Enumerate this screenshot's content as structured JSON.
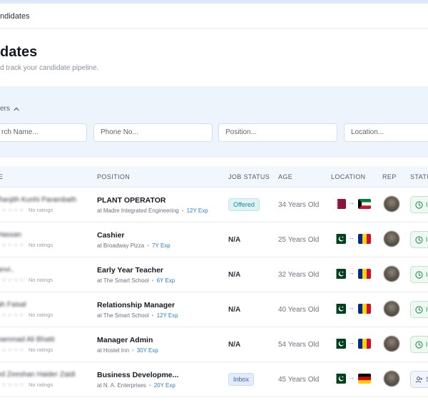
{
  "breadcrumb": "ndidates",
  "page": {
    "title": "dates",
    "subtitle": "d track your candidate pipeline."
  },
  "filters": {
    "toggle_label": "ers",
    "name_placeholder": "rch Name...",
    "phone_placeholder": "Phone No...",
    "position_placeholder": "Position...",
    "location_placeholder": "Location..."
  },
  "table": {
    "headers": {
      "name": "E",
      "position": "POSITION",
      "job_status": "JOB STATUS",
      "age": "AGE",
      "location": "LOCATION",
      "rep": "REP",
      "status": "STATU"
    },
    "rows": [
      {
        "name": "Ranjith Kunhi Parambath",
        "stars": "☆☆☆☆☆",
        "ratings": "No ratings",
        "position": "PLANT OPERATOR",
        "company": "at Madre Integrated Engineering",
        "exp": "12Y Exp",
        "job_status": "Offered",
        "age": "34 Years Old",
        "from_flag": "qatar",
        "to_flag": "kuwait",
        "status_icon": "clock-icon",
        "status_text": "I"
      },
      {
        "name": "Hassan",
        "stars": "☆☆☆☆☆",
        "ratings": "No ratings",
        "position": "Cashier",
        "company": "at Broadway Pizza",
        "exp": "7Y Exp",
        "job_status": "N/A",
        "age": "25 Years Old",
        "from_flag": "pakistan",
        "to_flag": "romania",
        "status_icon": "clock-icon",
        "status_text": "I"
      },
      {
        "name": "anvi..",
        "stars": "☆☆☆☆☆",
        "ratings": "No ratings",
        "position": "Early Year Teacher",
        "company": "at The Smart School",
        "exp": "6Y Exp",
        "job_status": "N/A",
        "age": "32 Years Old",
        "from_flag": "pakistan",
        "to_flag": "romania",
        "status_icon": "clock-icon",
        "status_text": "I"
      },
      {
        "name": "ah Faisal",
        "stars": "☆☆☆☆☆",
        "ratings": "No ratings",
        "position": "Relationship Manager",
        "company": "at The Smart School",
        "exp": "12Y Exp",
        "job_status": "N/A",
        "age": "40 Years Old",
        "from_flag": "pakistan",
        "to_flag": "romania",
        "status_icon": "clock-icon",
        "status_text": "I"
      },
      {
        "name": "hammad Ali Bhatti",
        "stars": "☆☆☆☆☆",
        "ratings": "No ratings",
        "position": "Manager Admin",
        "company": "at Hostel Inn",
        "exp": "30Y Exp",
        "job_status": "N/A",
        "age": "54 Years Old",
        "from_flag": "pakistan",
        "to_flag": "romania",
        "status_icon": "clock-icon",
        "status_text": "I"
      },
      {
        "name": "ed Zeeshan Haider Zaidi",
        "stars": "☆☆☆☆☆",
        "ratings": "No ratings",
        "position": "Business Developme...",
        "company": "at N. A. Enterprises",
        "exp": "20Y Exp",
        "job_status": "Inbox",
        "age": "45 Years Old",
        "from_flag": "pakistan",
        "to_flag": "germany",
        "status_icon": "user-icon",
        "status_text": "S"
      }
    ]
  },
  "colors": {
    "accent": "#2b7fd0",
    "offered": "#1d8a92",
    "inbox": "#3c62b4",
    "status_green": "#2e8a54"
  }
}
